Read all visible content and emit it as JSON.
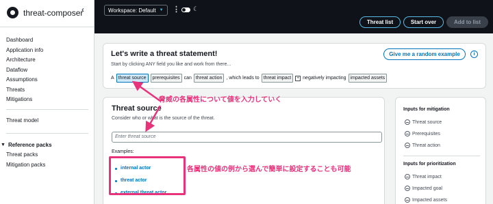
{
  "sidebar": {
    "brand": "threat-composer",
    "collapse_icon": "‹",
    "nav": [
      "Dashboard",
      "Application info",
      "Architecture",
      "Dataflow",
      "Assumptions",
      "Threats",
      "Mitigations"
    ],
    "threat_model": "Threat model",
    "ref_packs_title": "Reference packs",
    "ref_packs": [
      "Threat packs",
      "Mitigation packs"
    ]
  },
  "topbar": {
    "workspace": "Workspace: Default",
    "buttons": {
      "threat_list": "Threat list",
      "start_over": "Start over",
      "add_to_list": "Add to list"
    }
  },
  "statement": {
    "title": "Let's write a threat statement!",
    "subtitle": "Start by clicking ANY field you like and work from there...",
    "random_button": "Give me a random example",
    "info": "i",
    "line": {
      "a": "A",
      "threat_source": "threat source",
      "prerequisites": "prerequisites",
      "can": "can",
      "threat_action": "threat action",
      "leads_to": ", which leads to",
      "threat_impact": "threat impact",
      "plus": "+",
      "negatively": "negatively impacting",
      "impacted_assets": "impacted assets"
    }
  },
  "threat_source": {
    "title": "Threat source",
    "subtitle": "Consider who or what is the source of the threat.",
    "placeholder": "Enter threat source",
    "examples_label": "Examples:",
    "examples": [
      "internal actor",
      "threat actor",
      "external threat actor"
    ]
  },
  "side_inputs": {
    "mitigation_title": "Inputs for mitigation",
    "mitigation": [
      "Threat source",
      "Prerequisites",
      "Threat action"
    ],
    "prioritization_title": "Inputs for prioritization",
    "prioritization": [
      "Threat impact",
      "Impacted goal",
      "Impacted assets"
    ]
  },
  "annotations": {
    "top": "脅威の各属性について値を入力していく",
    "bottom": "各属性の値の例から選んで簡単に設定することも可能",
    "color": "#e8327a"
  }
}
